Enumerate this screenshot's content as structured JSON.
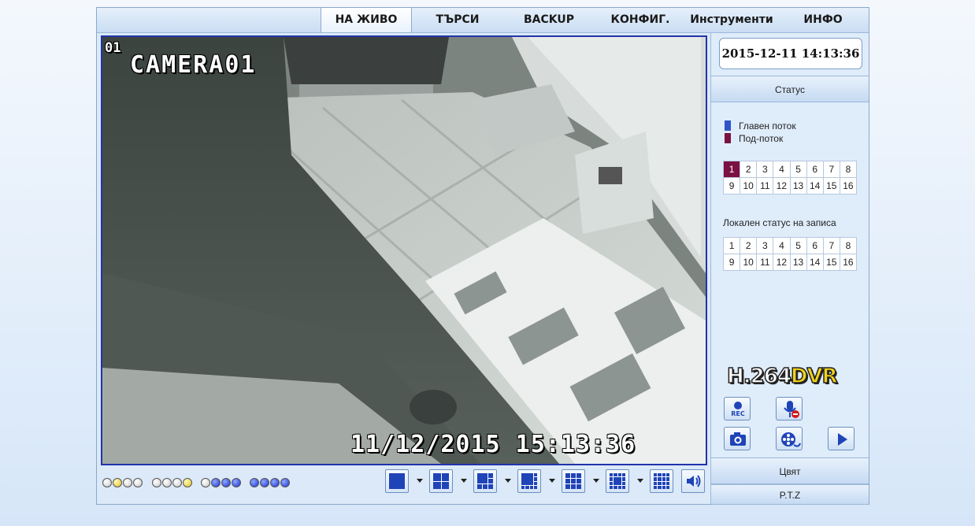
{
  "nav": {
    "tabs": [
      {
        "label": "НА ЖИВО",
        "active": true
      },
      {
        "label": "ТЪРСИ"
      },
      {
        "label": "BACKUP"
      },
      {
        "label": "КОНФИГ."
      },
      {
        "label": "Инструменти"
      },
      {
        "label": "ИНФО"
      }
    ]
  },
  "video": {
    "channel": "01",
    "camera_name": "CAMERA01",
    "timestamp": "11/12/2015 15:13:36"
  },
  "clock": "2015-12-11 14:13:36",
  "status": {
    "header": "Статус",
    "legend": [
      {
        "label": "Главен поток",
        "color": "#2f55c8"
      },
      {
        "label": "Под-поток",
        "color": "#7b1042"
      }
    ],
    "channels_row1": [
      "1",
      "2",
      "3",
      "4",
      "5",
      "6",
      "7",
      "8"
    ],
    "channels_row2": [
      "9",
      "10",
      "11",
      "12",
      "13",
      "14",
      "15",
      "16"
    ],
    "selected_channel": "1",
    "record_status_label": "Локален статус на записа"
  },
  "logo": {
    "part1": "H.264",
    "part2": "DVR"
  },
  "controls": {
    "rec_label": "REC"
  },
  "color_header": "Цвят",
  "ptz_header": "P.T.Z",
  "indicators": {
    "colors": [
      "off",
      "yellow",
      "off",
      "off",
      "off",
      "off",
      "off",
      "yellow",
      "off",
      "blue",
      "blue",
      "blue",
      "blue",
      "blue",
      "blue",
      "blue"
    ]
  },
  "layouts": [
    {
      "name": "layout-1",
      "grid": 1
    },
    {
      "name": "layout-4",
      "grid": 2
    },
    {
      "name": "layout-6",
      "grid": 3
    },
    {
      "name": "layout-8",
      "grid": 3
    },
    {
      "name": "layout-9",
      "grid": 3
    },
    {
      "name": "layout-13",
      "grid": 4
    },
    {
      "name": "layout-16",
      "grid": 4
    }
  ]
}
